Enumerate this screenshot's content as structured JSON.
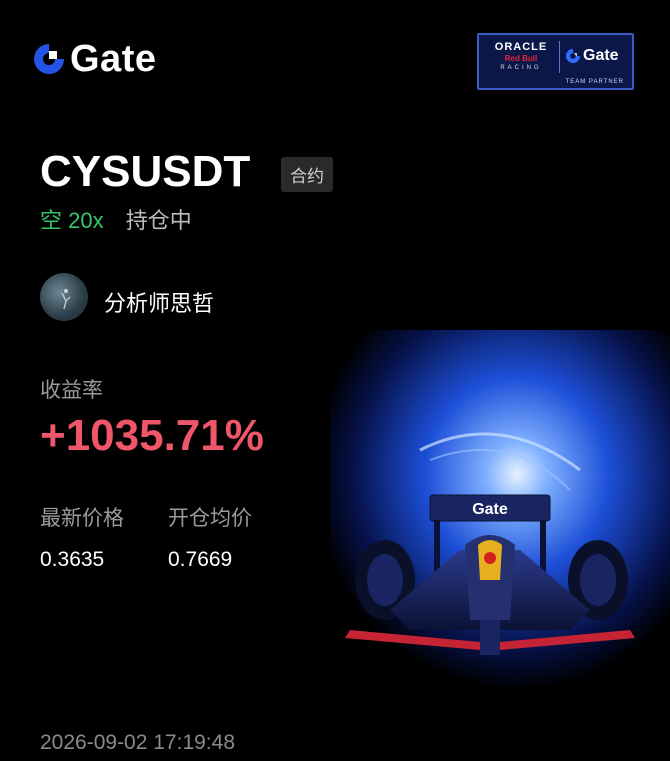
{
  "brand": {
    "name": "Gate",
    "accent": "#2354e6"
  },
  "partner_badge": {
    "oracle": "ORACLE",
    "redbull": "Red Bull",
    "racing": "RACING",
    "gate": "Gate",
    "label": "TEAM PARTNER"
  },
  "position": {
    "symbol": "CYSUSDT",
    "contract_type": "合约",
    "side": "空 20x",
    "status": "持仓中"
  },
  "author": {
    "name": "分析师思哲"
  },
  "roi": {
    "label": "收益率",
    "value": "+1035.71%"
  },
  "prices": {
    "latest_label": "最新价格",
    "latest_value": "0.3635",
    "entry_label": "开仓均价",
    "entry_value": "0.7669"
  },
  "timestamp": "2026-09-02 17:19:48",
  "car_banner": {
    "text": "Gate"
  },
  "colors": {
    "profit": "#f0566a",
    "short": "#34c56b"
  }
}
